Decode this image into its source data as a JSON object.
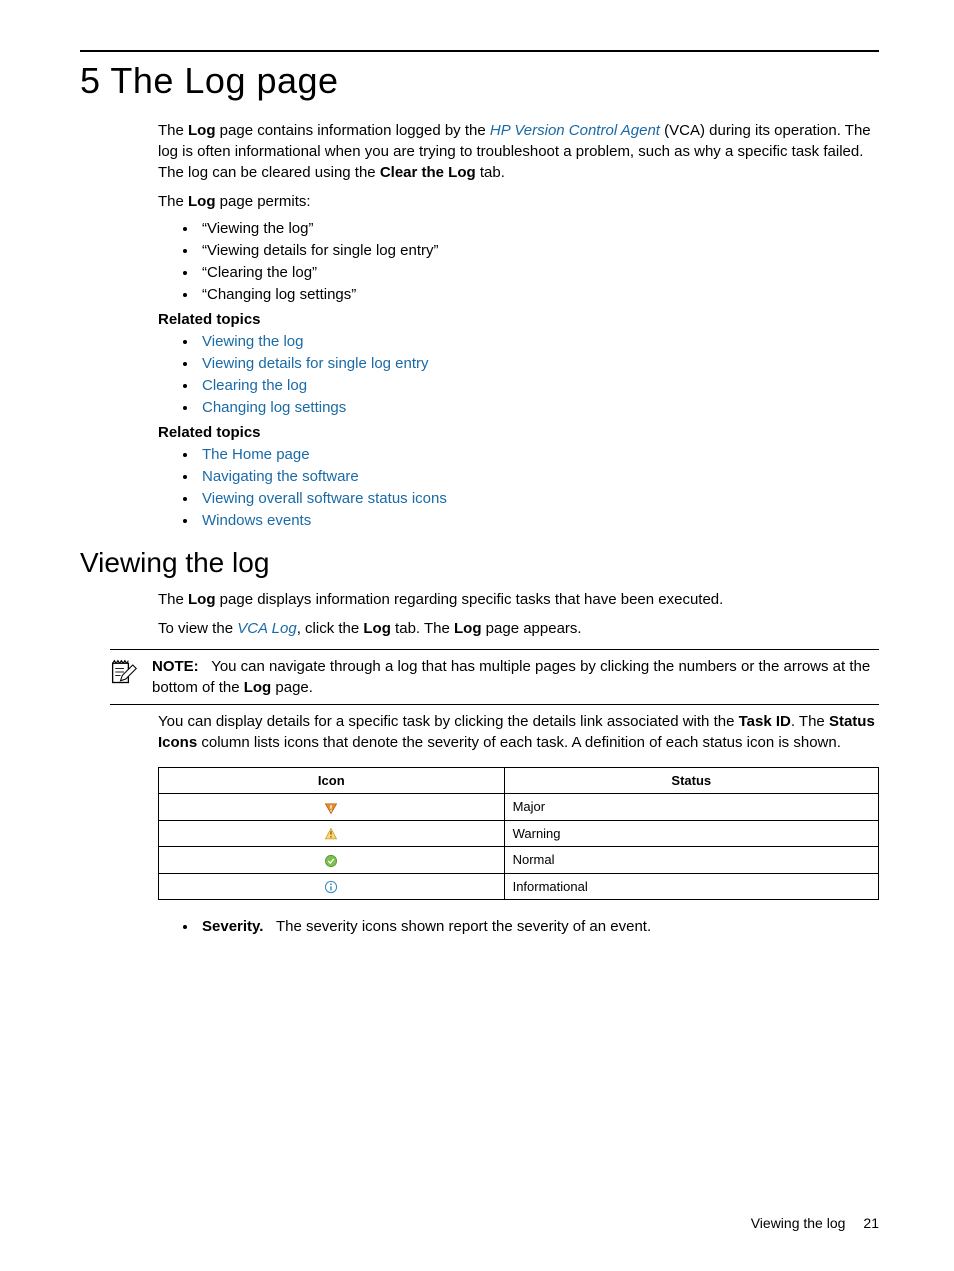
{
  "heading": "5 The Log page",
  "intro": {
    "p1_a": "The ",
    "p1_b": "Log",
    "p1_c": " page contains information logged by the ",
    "p1_link": "HP Version Control Agent",
    "p1_d": " (VCA) during its operation. The log is often informational when you are trying to troubleshoot a problem, such as why a specific task failed. The log can be cleared using the ",
    "p1_e": "Clear the Log",
    "p1_f": " tab.",
    "p2_a": "The ",
    "p2_b": "Log",
    "p2_c": " page permits:"
  },
  "permits": [
    "“Viewing the log”",
    "“Viewing details for single log entry”",
    "“Clearing the log”",
    "“Changing log settings”"
  ],
  "related1_label": "Related topics",
  "related1": [
    "Viewing the log",
    "Viewing details for single log entry",
    "Clearing the log",
    "Changing log settings"
  ],
  "related2_label": "Related topics",
  "related2": [
    "The Home page",
    "Navigating the software",
    "Viewing overall software status icons",
    "Windows events"
  ],
  "section2": {
    "heading": "Viewing the log",
    "p1_a": "The ",
    "p1_b": "Log",
    "p1_c": " page displays information regarding specific tasks that have been executed.",
    "p2_a": "To view the ",
    "p2_link": "VCA Log",
    "p2_b": ", click the ",
    "p2_c": "Log",
    "p2_d": " tab. The ",
    "p2_e": "Log",
    "p2_f": " page appears."
  },
  "note": {
    "label": "NOTE:",
    "text_a": "You can navigate through a log that has multiple pages by clicking the numbers or the arrows at the bottom of the ",
    "text_b": "Log",
    "text_c": " page."
  },
  "afterNote": {
    "a": "You can display details for a specific task by clicking the details link associated with the ",
    "b": "Task ID",
    "c": ". The ",
    "d": "Status Icons",
    "e": " column lists icons that denote the severity of each task. A definition of each status icon is shown."
  },
  "table": {
    "headers": {
      "icon": "Icon",
      "status": "Status"
    },
    "rows": [
      {
        "status": "Major"
      },
      {
        "status": "Warning"
      },
      {
        "status": "Normal"
      },
      {
        "status": "Informational"
      }
    ]
  },
  "severity": {
    "label": "Severity.",
    "text": "The severity icons shown report the severity of an event."
  },
  "footer": {
    "title": "Viewing the log",
    "page": "21"
  }
}
